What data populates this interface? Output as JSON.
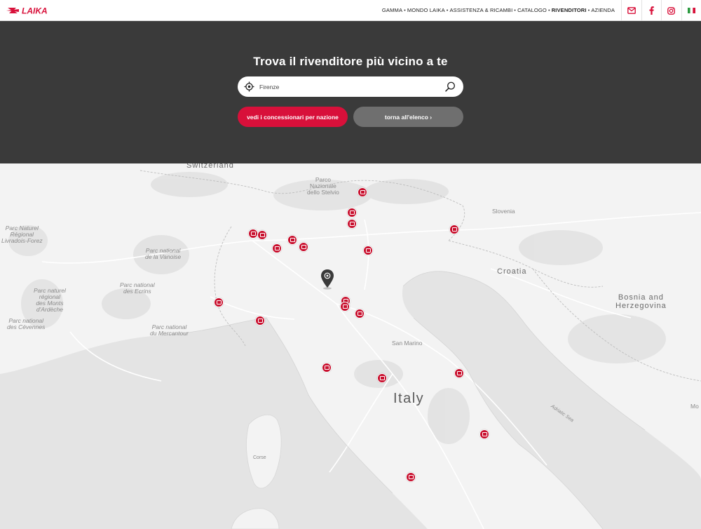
{
  "header": {
    "logo_text": "LAIKA",
    "nav": [
      {
        "label": "GAMMA",
        "active": false
      },
      {
        "label": "MONDO LAIKA",
        "active": false
      },
      {
        "label": "ASSISTENZA & RICAMBI",
        "active": false
      },
      {
        "label": "CATALOGO",
        "active": false
      },
      {
        "label": "RIVENDITORI",
        "active": true
      },
      {
        "label": "AZIENDA",
        "active": false
      }
    ],
    "separator": "•",
    "socials": [
      "mail-icon",
      "facebook-icon",
      "instagram-icon",
      "italian-flag-icon"
    ]
  },
  "hero": {
    "title": "Trova il rivenditore più vicino a te",
    "search": {
      "value": "Firenze"
    },
    "btn_nations": "vedi i concessionari per nazione",
    "btn_list": "torna all'elenco ›"
  },
  "colors": {
    "accent": "#d8103a",
    "hero_bg": "#3a3a3a",
    "secondary_btn": "#6f6f6f"
  },
  "map": {
    "labels": {
      "switzerland": "Switzerland",
      "stelvio": "Parco\nNazionale\ndello Stelvio",
      "slovenia": "Slovenia",
      "livradois": "Parc Naturel\nRégional\nLivradois-Forez",
      "vanoise": "Parc national\nde la Vanoise",
      "croatia": "Croatia",
      "ecrins": "Parc national\ndes Ecrins",
      "monts": "Parc naturel\nrégional\ndes Monts\nd'Ardèche",
      "cevennes": "Parc national\ndes Cévennes",
      "mercantour": "Parc national\ndu Mercantour",
      "bosnia": "Bosnia and\nHerzegovina",
      "san_marino": "San Marino",
      "italy": "Italy",
      "adriatic": "Adriatic Sea",
      "corse": "Corse",
      "mo": "Mo"
    },
    "dealer_count": 23
  }
}
